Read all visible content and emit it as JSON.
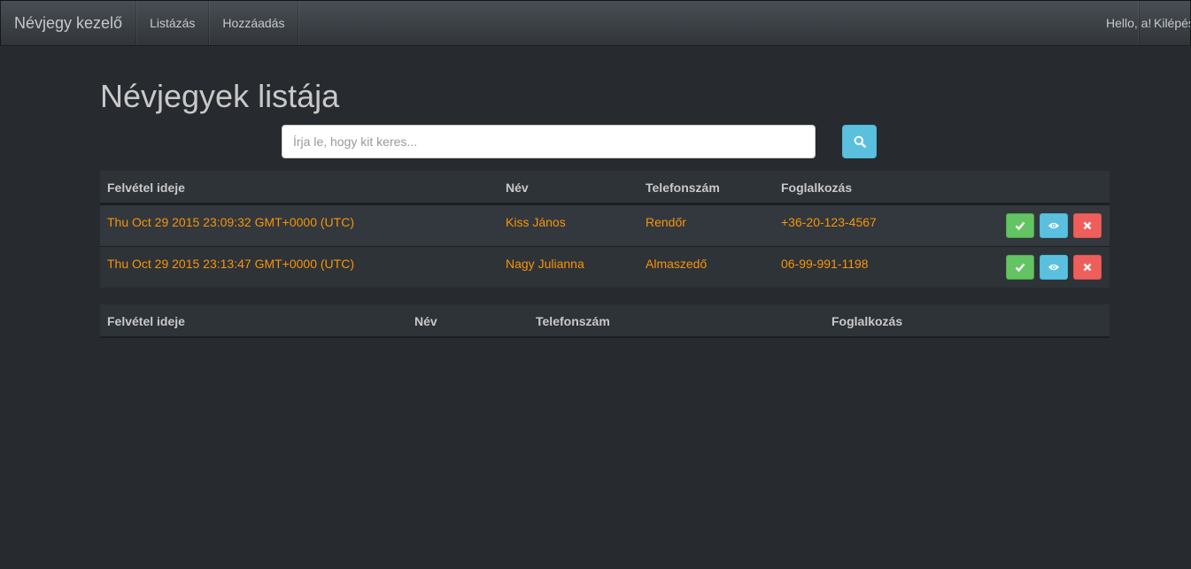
{
  "navbar": {
    "brand": "Névjegy kezelő",
    "links": [
      "Listázás",
      "Hozzáadás"
    ],
    "greeting": "Hello, a!",
    "logout": "Kilépés"
  },
  "page": {
    "title": "Névjegyek listája"
  },
  "search": {
    "placeholder": "Írja le, hogy kit keres...",
    "value": "",
    "button_icon": "search-icon"
  },
  "table1": {
    "headers": [
      "Felvétel ideje",
      "Név",
      "Telefonszám",
      "Foglalkozás"
    ],
    "rows": [
      [
        "Thu Oct 29 2015 23:09:32 GMT+0000 (UTC)",
        "Kiss János",
        "Rendőr",
        "+36-20-123-4567"
      ],
      [
        "Thu Oct 29 2015 23:13:47 GMT+0000 (UTC)",
        "Nagy Julianna",
        "Almaszedő",
        "06-99-991-1198"
      ]
    ],
    "row_actions": [
      "check-icon",
      "eye-icon",
      "times-icon"
    ]
  },
  "table2": {
    "headers": [
      "Felvétel ideje",
      "Név",
      "Telefonszám",
      "Foglalkozás"
    ],
    "rows": []
  },
  "colors": {
    "background": "#272b30",
    "row_text": "#f89406",
    "success": "#62c462",
    "info": "#5bc0de",
    "danger": "#ee5f5b"
  }
}
